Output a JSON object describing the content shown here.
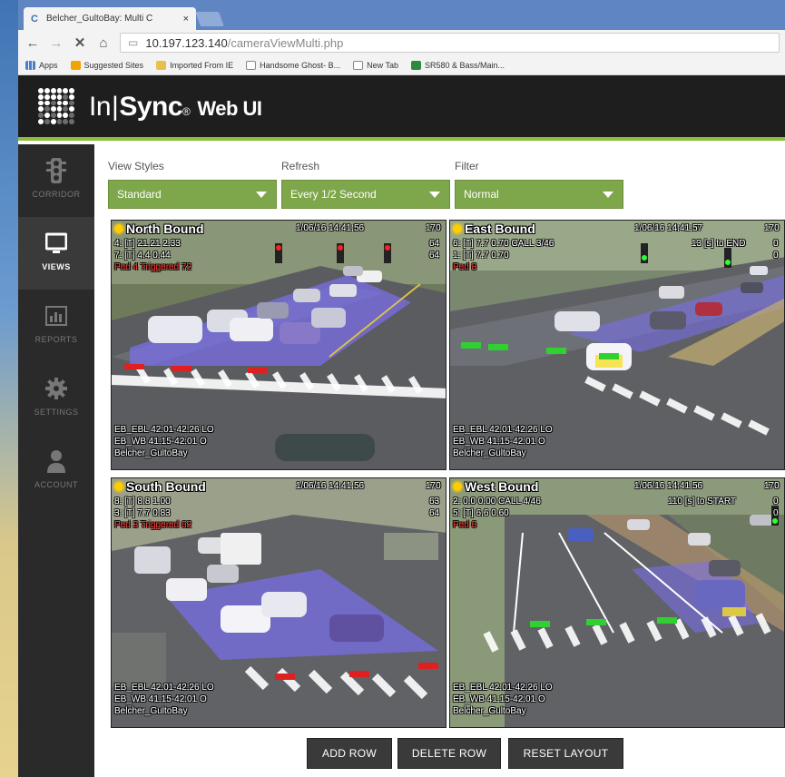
{
  "browser": {
    "tab_title": "Belcher_GultoBay: Multi C",
    "tab_close": "×",
    "url_host": "10.197.123.140",
    "url_path": "/cameraViewMulti.php",
    "bookmarks": [
      "Apps",
      "Suggested Sites",
      "Imported From IE",
      "Handsome Ghost- B...",
      "New Tab",
      "SR580 & Bass/Main..."
    ]
  },
  "app": {
    "brand_in": "In",
    "brand_bar": "|",
    "brand_sync": "Sync",
    "brand_mark": "®",
    "brand_suffix": "Web UI"
  },
  "sidebar": {
    "items": [
      {
        "label": "CORRIDOR",
        "icon": "traffic-light-icon",
        "active": false
      },
      {
        "label": "VIEWS",
        "icon": "monitor-icon",
        "active": true
      },
      {
        "label": "REPORTS",
        "icon": "bar-chart-icon",
        "active": false
      },
      {
        "label": "SETTINGS",
        "icon": "gear-icon",
        "active": false
      },
      {
        "label": "ACCOUNT",
        "icon": "user-icon",
        "active": false
      }
    ]
  },
  "controls": {
    "view_styles_label": "View Styles",
    "view_styles_value": "Standard",
    "refresh_label": "Refresh",
    "refresh_value": "Every 1/2 Second",
    "filter_label": "Filter",
    "filter_value": "Normal"
  },
  "cameras": [
    {
      "title": "North Bound",
      "timestamp": "1/06/16 14:41:56",
      "corner": "170",
      "line1": "4: [T] 21.21 2.33",
      "line1_right": "64",
      "line2": "7: [T] 4.4 0.44",
      "line2_right": "64",
      "line3": "Ped 4 Triggered 72",
      "footer1": "EB_EBL 42:01-42:26 LO",
      "footer2": "EB_WB 41:15-42:01 O",
      "footer3": "Belcher_GultoBay",
      "zone_color": "red"
    },
    {
      "title": "East Bound",
      "timestamp": "1/06/16 14:41:57",
      "corner": "170",
      "line1": "6: [T] 7.7 0.70 CALL 3/46",
      "line1_right": "13 [s] to END",
      "line1_right2": "0",
      "line2": "1: [T] 7.7 0.70",
      "line2_right": "0",
      "line3": "Ped 8",
      "footer1": "EB_EBL 42:01-42:26 LO",
      "footer2": "EB_WB 41:15-42:01 O",
      "footer3": "Belcher_GultoBay",
      "zone_color": "green"
    },
    {
      "title": "South Bound",
      "timestamp": "1/06/16 14:41:56",
      "corner": "170",
      "line1": "8: [T] 8.8 1.00",
      "line1_right": "63",
      "line2": "3: [T] 7.7 0.83",
      "line2_right": "64",
      "line3": "Ped 3 Triggered 62",
      "footer1": "EB_EBL 42:01-42:26 LO",
      "footer2": "EB_WB 41:15-42:01 O",
      "footer3": "Belcher_GultoBay",
      "zone_color": "red"
    },
    {
      "title": "West Bound",
      "timestamp": "1/06/16 14:41:56",
      "corner": "170",
      "line1": "2: 0.0 0.00 CALL 4/46",
      "line1_right": "110 [s] to START",
      "line1_right2": "0",
      "line2": "5: [T] 6.6 0.60",
      "line2_right": "0",
      "line3": "Ped 6",
      "footer1": "EB_EBL 42:01-42:26 LO",
      "footer2": "EB_WB 41:15-42:01 O",
      "footer3": "Belcher_GultoBay",
      "zone_color": "green"
    }
  ],
  "buttons": {
    "add_row": "ADD ROW",
    "delete_row": "DELETE ROW",
    "reset_layout": "RESET LAYOUT"
  },
  "colors": {
    "accent_green": "#7ea64a",
    "header_bg": "#1e1e1e",
    "sidebar_bg": "#2a2a2a",
    "zone_purple": "#7a6ff0"
  }
}
